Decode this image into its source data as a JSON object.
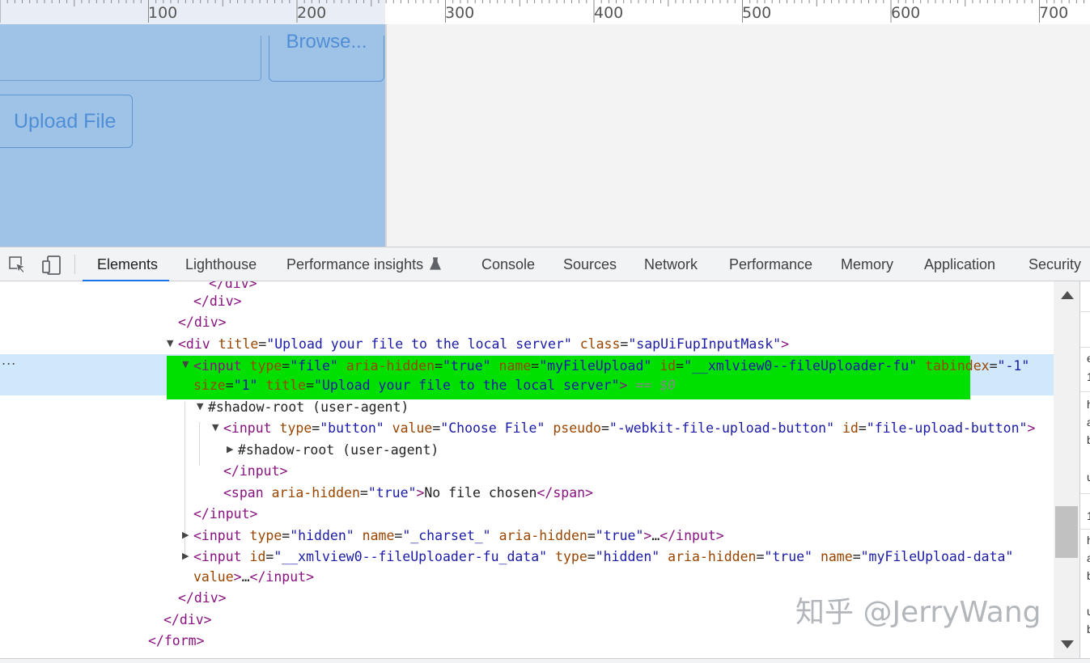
{
  "ruler": {
    "labels": [
      "100",
      "200",
      "300",
      "400",
      "500",
      "600",
      "700"
    ]
  },
  "page": {
    "browse_label": "Browse...",
    "upload_label": "Upload File"
  },
  "toolbar": {
    "tabs": [
      {
        "label": "Elements",
        "active": true
      },
      {
        "label": "Lighthouse"
      },
      {
        "label": "Performance insights"
      },
      {
        "label": "Console"
      },
      {
        "label": "Sources"
      },
      {
        "label": "Network"
      },
      {
        "label": "Performance"
      },
      {
        "label": "Memory"
      },
      {
        "label": "Application"
      },
      {
        "label": "Security"
      }
    ],
    "icons": [
      "inspect-element-icon",
      "device-toolbar-icon",
      "flask-icon"
    ]
  },
  "tree": {
    "row_truncated": "</div>",
    "row_close_div_1": "</div>",
    "row_close_div_2": "</div>",
    "row_div_mask": {
      "tag_open": "<div",
      "a1": "title",
      "v1": "\"Upload your file to the local server\"",
      "a2": "class",
      "v2": "\"sapUiFupInputMask\"",
      "tag_end": ">"
    },
    "row_selected": {
      "tag_open": "<input",
      "a1": "type",
      "v1": "\"file\"",
      "a2": "aria-hidden",
      "v2": "\"true\"",
      "a3": "name",
      "v3": "\"myFileUpload\"",
      "a4": "id",
      "v4": "\"__xmlview0--fileUploader-fu\"",
      "a5": "tabindex",
      "v5": "\"-1\"",
      "a6": "size",
      "v6": "\"1\"",
      "a7": "title",
      "v7": "\"Upload your file to the local server\"",
      "tag_end": ">",
      "eq_marker": "== $0",
      "ellipsis": "..."
    },
    "row_shadow_root": "#shadow-root (user-agent)",
    "row_input_button": {
      "tag_open": "<input",
      "a1": "type",
      "v1": "\"button\"",
      "a2": "value",
      "v2": "\"Choose File\"",
      "a3": "pseudo",
      "v3": "\"-webkit-file-upload-button\"",
      "a4": "id",
      "v4": "\"file-upload-button\"",
      "tag_end": ">"
    },
    "row_shadow_root_inner": "#shadow-root (user-agent)",
    "row_close_input_inner": "</input>",
    "row_span": {
      "tag_open": "<span",
      "a1": "aria-hidden",
      "v1": "\"true\"",
      "gt": ">",
      "text": "No file chosen",
      "tag_close": "</span>"
    },
    "row_close_input": "</input>",
    "row_hidden_charset": {
      "tag_open": "<input",
      "a1": "type",
      "v1": "\"hidden\"",
      "a2": "name",
      "v2": "\"_charset_\"",
      "a3": "aria-hidden",
      "v3": "\"true\"",
      "gt": ">",
      "ellipsis": "…",
      "tag_close": "</input>"
    },
    "row_hidden_data": {
      "tag_open": "<input",
      "a1": "id",
      "v1": "\"__xmlview0--fileUploader-fu_data\"",
      "a2": "type",
      "v2": "\"hidden\"",
      "a3": "aria-hidden",
      "v3": "\"true\"",
      "a4": "name",
      "v4": "\"myFileUpload-data\"",
      "a5": "value",
      "gt": ">",
      "ellipsis": "…",
      "tag_close": "</input>"
    },
    "row_close_div_3": "</div>",
    "row_close_div_4": "</div>",
    "row_close_form": "</form>"
  },
  "side_pane": {
    "fragments": [
      "e",
      "1",
      "h",
      "a",
      "b",
      "u",
      "1",
      "h",
      "a",
      "b",
      "u",
      "b"
    ]
  },
  "watermark": "知乎 @JerryWang"
}
